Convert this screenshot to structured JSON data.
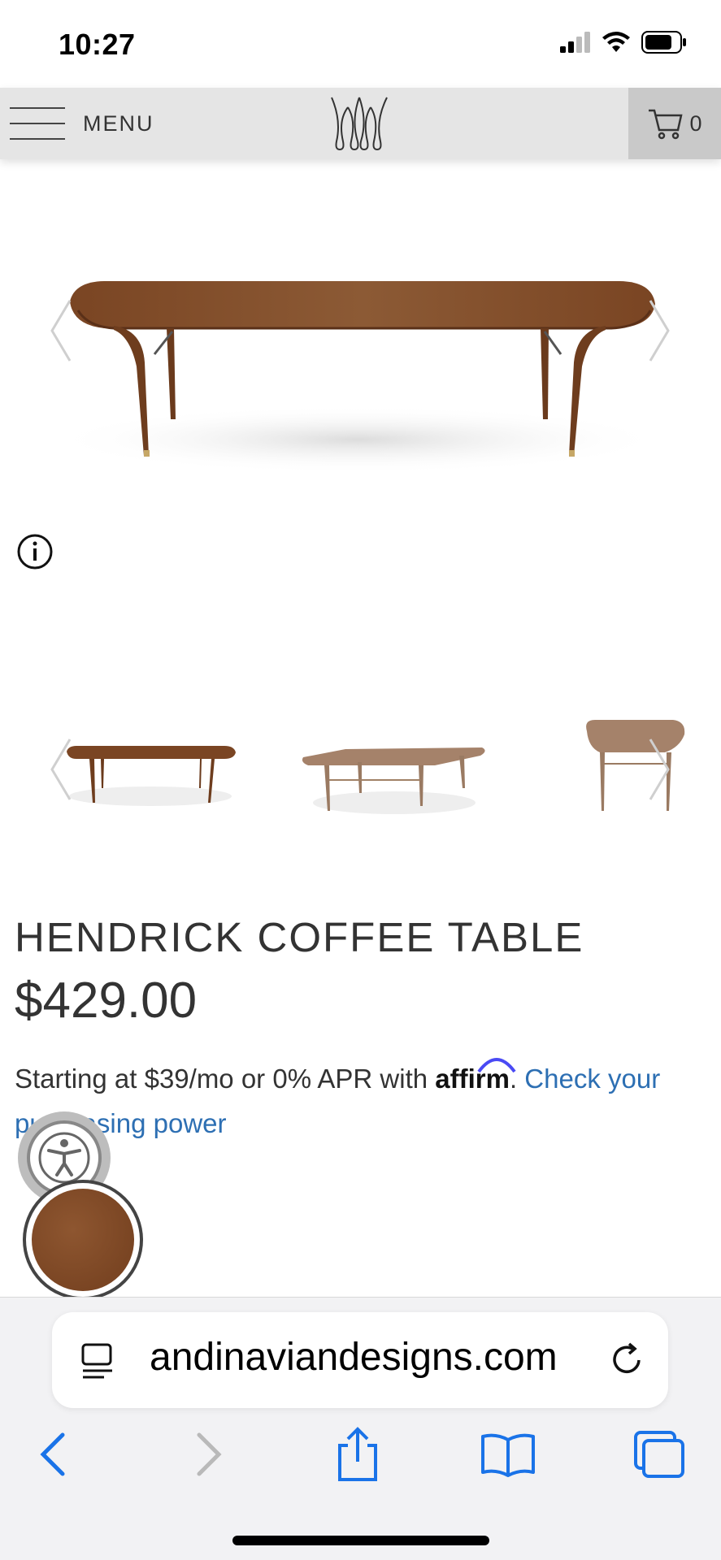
{
  "status_bar": {
    "time": "10:27"
  },
  "header": {
    "menu_label": "MENU",
    "cart_count": "0"
  },
  "product": {
    "title": "HENDRICK COFFEE TABLE",
    "price": "$429.00",
    "financing": {
      "prefix": "Starting at $39/mo or 0% APR with",
      "brand": "affirm",
      "suffix": ".",
      "link": "Check your purchasing power"
    }
  },
  "browser": {
    "url": "andinaviandesigns.com"
  },
  "colors": {
    "wood": "#7a4523",
    "link": "#2d6fb3",
    "ios_blue": "#1a73e8"
  }
}
